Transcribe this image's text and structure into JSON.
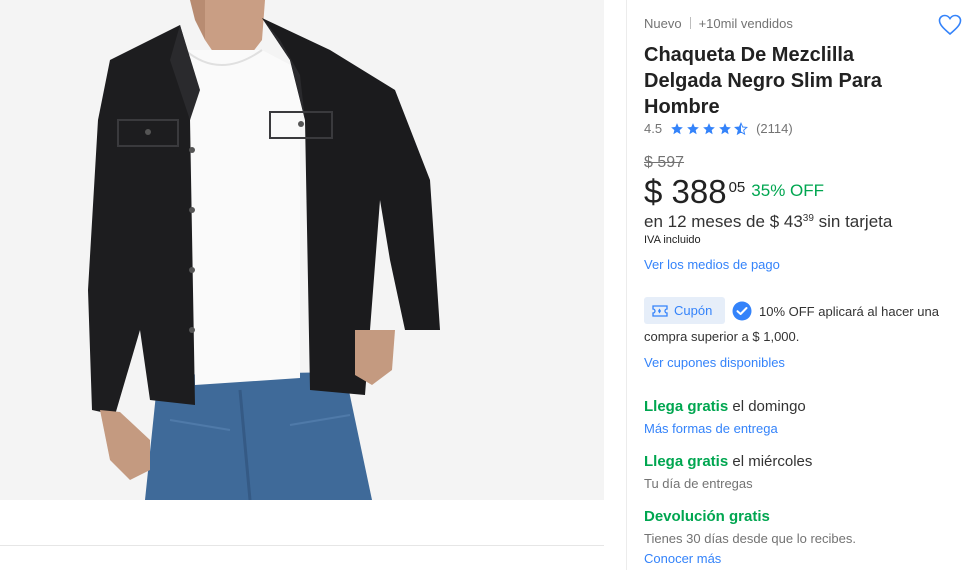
{
  "product": {
    "condition": "Nuevo",
    "sold": "+10mil vendidos",
    "title": "Chaqueta De Mezclilla Delgada Negro Slim Para Hombre",
    "rating_value": "4.5",
    "rating_stars": 4.5,
    "review_count": "(2114)",
    "favorite_icon": "heart-outline-icon",
    "image_alt": "Hombre con chaqueta de mezclilla negra, camiseta blanca y jeans"
  },
  "price": {
    "old": "$ 597",
    "main": "$ 388",
    "cents": "05",
    "discount": "35% OFF",
    "installments_prefix": "en 12 meses de $ 43",
    "installments_cents": "39",
    "installments_suffix": " sin tarjeta",
    "tax_note": "IVA incluido",
    "payment_link": "Ver los medios de pago"
  },
  "coupon": {
    "tag_label": "Cupón",
    "text_line1": "10% OFF aplicará al hacer una",
    "text_line2": "compra superior a $ 1,000.",
    "link": "Ver cupones disponibles"
  },
  "shipping": {
    "option1_highlight": "Llega gratis",
    "option1_rest": " el domingo",
    "option1_link": "Más formas de entrega",
    "option2_highlight": "Llega gratis",
    "option2_rest": " el miércoles",
    "option2_sub": "Tu día de entregas"
  },
  "returns": {
    "title": "Devolución gratis",
    "text": "Tienes 30 días desde que lo recibes.",
    "link": "Conocer más"
  },
  "colors": {
    "accent_blue": "#3483fa",
    "success_green": "#00a650",
    "coupon_bg": "#e6eef9"
  }
}
